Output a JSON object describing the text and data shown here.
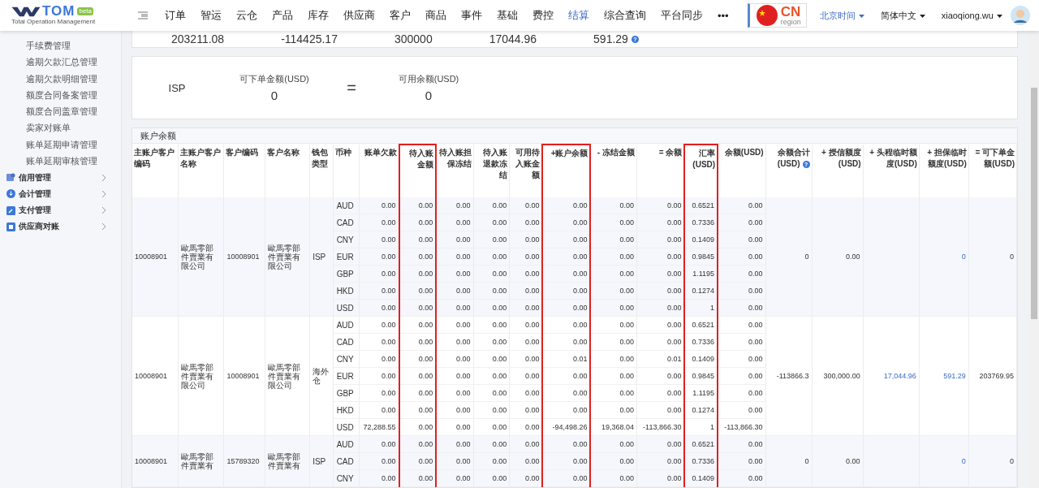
{
  "logo": {
    "name": "TOM",
    "badge": "beta",
    "tagline": "Total Operation Management"
  },
  "nav": [
    {
      "label": "订单",
      "selected": false
    },
    {
      "label": "智运",
      "selected": false
    },
    {
      "label": "云仓",
      "selected": false
    },
    {
      "label": "产品",
      "selected": false
    },
    {
      "label": "库存",
      "selected": false
    },
    {
      "label": "供应商",
      "selected": false
    },
    {
      "label": "客户",
      "selected": false
    },
    {
      "label": "商品",
      "selected": false
    },
    {
      "label": "事件",
      "selected": false
    },
    {
      "label": "基础",
      "selected": false
    },
    {
      "label": "费控",
      "selected": false
    },
    {
      "label": "结算",
      "selected": true
    },
    {
      "label": "综合查询",
      "selected": false
    },
    {
      "label": "平台同步",
      "selected": false
    },
    {
      "label": "•••",
      "selected": false
    }
  ],
  "region": {
    "code": "CN",
    "caption": "region"
  },
  "timezone": "北京时间",
  "language": "简体中文",
  "user": "xiaoqiong.wu",
  "sidebar": {
    "items": [
      "手续费管理",
      "逾期欠款汇总管理",
      "逾期欠款明细管理",
      "额度合同备案管理",
      "额度合同盖章管理",
      "卖家对账单",
      "账单延期申请管理",
      "账单延期审核管理"
    ],
    "groups": [
      {
        "label": "信用管理",
        "expanded": false
      },
      {
        "label": "会计管理",
        "expanded": false
      },
      {
        "label": "支付管理",
        "expanded": false
      },
      {
        "label": "供应商对账",
        "expanded": false
      }
    ]
  },
  "summary_strip": [
    {
      "value": "203211.08"
    },
    {
      "value": "-114425.17"
    },
    {
      "value": "300000"
    },
    {
      "value": "17044.96"
    },
    {
      "value": "591.29",
      "help": "?"
    }
  ],
  "isp_card": {
    "label": "ISP",
    "left": {
      "label": "可下单金额(USD)",
      "value": "0"
    },
    "operator": "=",
    "right": {
      "label": "可用余额(USD)",
      "value": "0"
    }
  },
  "table": {
    "title": "账户余额",
    "columns": [
      {
        "label": "主账户客户编码",
        "highlighted": false,
        "help": false
      },
      {
        "label": "主账户客户名称",
        "highlighted": false,
        "help": false
      },
      {
        "label": "客户编码",
        "highlighted": false,
        "help": false
      },
      {
        "label": "客户名称",
        "highlighted": false,
        "help": false
      },
      {
        "label": "钱包类型",
        "highlighted": false,
        "help": false
      },
      {
        "label": "币种",
        "highlighted": false,
        "help": false
      },
      {
        "label": "账单欠款",
        "highlighted": false,
        "help": false
      },
      {
        "label": "待入账金额",
        "highlighted": true,
        "help": false
      },
      {
        "label": "待入账担保冻结",
        "highlighted": false,
        "help": false
      },
      {
        "label": "待入账退款冻结",
        "highlighted": false,
        "help": false
      },
      {
        "label": "可用待入账金额",
        "highlighted": false,
        "help": false
      },
      {
        "label": "+账户余额",
        "highlighted": true,
        "help": false
      },
      {
        "label": "- 冻结金额",
        "highlighted": false,
        "help": false
      },
      {
        "label": "= 余额",
        "highlighted": false,
        "help": false
      },
      {
        "label": "汇率(USD)",
        "highlighted": true,
        "help": false
      },
      {
        "label": "余额(USD)",
        "highlighted": false,
        "help": false
      },
      {
        "label": "余额合计(USD)",
        "highlighted": false,
        "help": "?"
      },
      {
        "label": "+ 授信额度(USD)",
        "highlighted": false,
        "help": false
      },
      {
        "label": "+ 头程临时额度(USD)",
        "highlighted": false,
        "help": false
      },
      {
        "label": "+ 担保临时额度(USD)",
        "highlighted": false,
        "help": false
      },
      {
        "label": "= 可下单金额(USD)",
        "highlighted": false,
        "help": false
      }
    ],
    "groups": [
      {
        "master_code": "10008901",
        "master_name": "歐馬零部件賣業有限公司",
        "code": "10008901",
        "name": "歐馬零部件賣業有限公司",
        "wallet": "ISP",
        "rows": [
          {
            "currency": "AUD",
            "values": [
              "0.00",
              "0.00",
              "0.00",
              "0.00",
              "0.00",
              "0.00",
              "0.00",
              "0.00",
              "0.6521",
              "0.00"
            ]
          },
          {
            "currency": "CAD",
            "values": [
              "0.00",
              "0.00",
              "0.00",
              "0.00",
              "0.00",
              "0.00",
              "0.00",
              "0.00",
              "0.7336",
              "0.00"
            ]
          },
          {
            "currency": "CNY",
            "values": [
              "0.00",
              "0.00",
              "0.00",
              "0.00",
              "0.00",
              "0.00",
              "0.00",
              "0.00",
              "0.1409",
              "0.00"
            ]
          },
          {
            "currency": "EUR",
            "values": [
              "0.00",
              "0.00",
              "0.00",
              "0.00",
              "0.00",
              "0.00",
              "0.00",
              "0.00",
              "0.9845",
              "0.00"
            ]
          },
          {
            "currency": "GBP",
            "values": [
              "0.00",
              "0.00",
              "0.00",
              "0.00",
              "0.00",
              "0.00",
              "0.00",
              "0.00",
              "1.1195",
              "0.00"
            ]
          },
          {
            "currency": "HKD",
            "values": [
              "0.00",
              "0.00",
              "0.00",
              "0.00",
              "0.00",
              "0.00",
              "0.00",
              "0.00",
              "0.1274",
              "0.00"
            ]
          },
          {
            "currency": "USD",
            "values": [
              "0.00",
              "0.00",
              "0.00",
              "0.00",
              "0.00",
              "0.00",
              "0.00",
              "0.00",
              "1",
              "0.00"
            ]
          }
        ],
        "totals": [
          {
            "value": "0",
            "link": false
          },
          {
            "value": "0.00",
            "link": false
          },
          {
            "link": false
          },
          {
            "value": "0",
            "link": true
          },
          {
            "value": "0",
            "link": false
          }
        ]
      },
      {
        "master_code": "10008901",
        "master_name": "歐馬零部件賣業有限公司",
        "code": "10008901",
        "name": "歐馬零部件賣業有限公司",
        "wallet": "海外仓",
        "rows": [
          {
            "currency": "AUD",
            "values": [
              "0.00",
              "0.00",
              "0.00",
              "0.00",
              "0.00",
              "0.00",
              "0.00",
              "0.00",
              "0.6521",
              "0.00"
            ]
          },
          {
            "currency": "CAD",
            "values": [
              "0.00",
              "0.00",
              "0.00",
              "0.00",
              "0.00",
              "0.00",
              "0.00",
              "0.00",
              "0.7336",
              "0.00"
            ]
          },
          {
            "currency": "CNY",
            "values": [
              "0.00",
              "0.00",
              "0.00",
              "0.00",
              "0.00",
              "0.01",
              "0.00",
              "0.01",
              "0.1409",
              "0.00"
            ]
          },
          {
            "currency": "EUR",
            "values": [
              "0.00",
              "0.00",
              "0.00",
              "0.00",
              "0.00",
              "0.00",
              "0.00",
              "0.00",
              "0.9845",
              "0.00"
            ]
          },
          {
            "currency": "GBP",
            "values": [
              "0.00",
              "0.00",
              "0.00",
              "0.00",
              "0.00",
              "0.00",
              "0.00",
              "0.00",
              "1.1195",
              "0.00"
            ]
          },
          {
            "currency": "HKD",
            "values": [
              "0.00",
              "0.00",
              "0.00",
              "0.00",
              "0.00",
              "0.00",
              "0.00",
              "0.00",
              "0.1274",
              "0.00"
            ]
          },
          {
            "currency": "USD",
            "values": [
              "72,288.55",
              "0.00",
              "0.00",
              "0.00",
              "0.00",
              "-94,498.26",
              "19,368.04",
              "-113,866.30",
              "1",
              "-113,866.30"
            ]
          }
        ],
        "totals": [
          {
            "value": "-113866.3",
            "link": false
          },
          {
            "value": "300,000.00",
            "link": false
          },
          {
            "value": "17,044.96",
            "link": true
          },
          {
            "value": "591.29",
            "link": true
          },
          {
            "value": "203769.95",
            "link": false
          }
        ]
      },
      {
        "master_code": "10008901",
        "master_name": "歐馬零部件賣業有",
        "code": "15789320",
        "name": "歐馬零部件賣業有",
        "wallet": "ISP",
        "rows": [
          {
            "currency": "AUD",
            "values": [
              "0.00",
              "0.00",
              "0.00",
              "0.00",
              "0.00",
              "0.00",
              "0.00",
              "0.00",
              "0.6521",
              "0.00"
            ]
          },
          {
            "currency": "CAD",
            "values": [
              "0.00",
              "0.00",
              "0.00",
              "0.00",
              "0.00",
              "0.00",
              "0.00",
              "0.00",
              "0.7336",
              "0.00"
            ]
          },
          {
            "currency": "CNY",
            "values": [
              "0.00",
              "0.00",
              "0.00",
              "0.00",
              "0.00",
              "0.00",
              "0.00",
              "0.00",
              "0.1409",
              "0.00"
            ]
          }
        ],
        "totals": [
          {
            "value": "0",
            "link": false
          },
          {
            "value": "0.00",
            "link": false
          },
          {
            "link": false
          },
          {
            "value": "0",
            "link": true
          },
          {
            "value": "0",
            "link": false
          }
        ]
      }
    ]
  }
}
